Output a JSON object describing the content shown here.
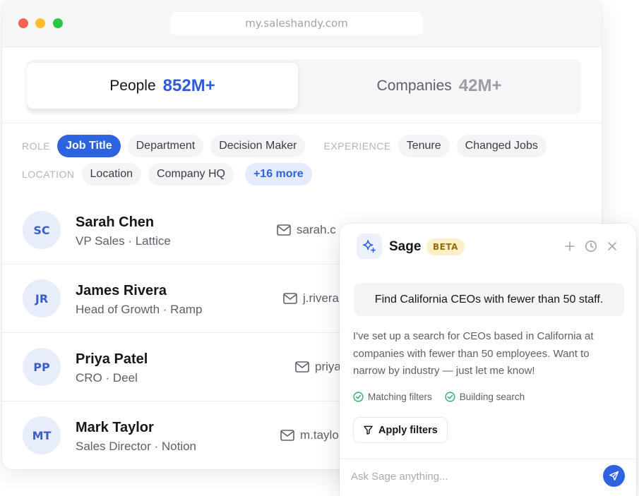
{
  "browser": {
    "url": "my.saleshandy.com"
  },
  "tabs": [
    {
      "label": "People",
      "count": "852M+"
    },
    {
      "label": "Companies",
      "count": "42M+"
    }
  ],
  "filters": {
    "role_label": "ROLE",
    "role_chips": [
      "Job Title",
      "Department",
      "Decision Maker"
    ],
    "experience_label": "EXPERIENCE",
    "experience_chips": [
      "Tenure",
      "Changed Jobs"
    ],
    "location_label": "LOCATION",
    "location_chips": [
      "Location",
      "Company HQ"
    ],
    "more": "+16 more"
  },
  "people": [
    {
      "initials": "SC",
      "name": "Sarah Chen",
      "role": "VP Sales · Lattice",
      "email": "sarah.c"
    },
    {
      "initials": "JR",
      "name": "James Rivera",
      "role": "Head of Growth · Ramp",
      "email": "j.rivera"
    },
    {
      "initials": "PP",
      "name": "Priya Patel",
      "role": "CRO · Deel",
      "email": "priya"
    },
    {
      "initials": "MT",
      "name": "Mark Taylor",
      "role": "Sales Director · Notion",
      "email": "m.taylo"
    }
  ],
  "sage": {
    "title": "Sage",
    "badge": "BETA",
    "user_message": "Find California CEOs with fewer than 50 staff.",
    "ai_message": "I've set up a search for CEOs based in California at companies with fewer than 50 employees. Want to narrow by industry — just let me know!",
    "steps": [
      "Matching filters",
      "Building search"
    ],
    "apply_label": "Apply filters",
    "input_placeholder": "Ask Sage anything..."
  }
}
